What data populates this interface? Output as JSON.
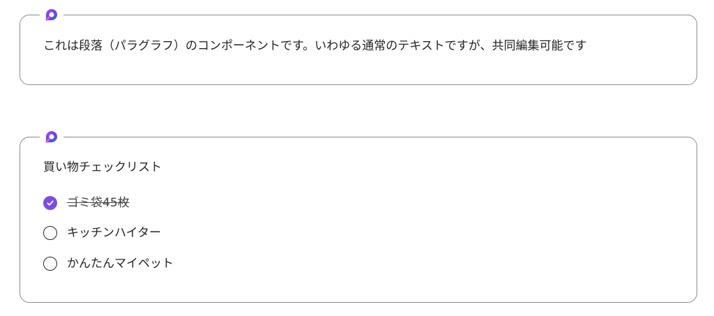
{
  "paragraph_component": {
    "logo_icon": "loop-logo-icon",
    "text": "これは段落（パラグラフ）のコンポーネントです。いわゆる通常のテキストですが、共同編集可能です"
  },
  "checklist_component": {
    "logo_icon": "loop-logo-icon",
    "title": "買い物チェックリスト",
    "items": [
      {
        "label": "ゴミ袋45枚",
        "checked": true
      },
      {
        "label": "キッチンハイター",
        "checked": false
      },
      {
        "label": "かんたんマイペット",
        "checked": false
      }
    ]
  },
  "colors": {
    "checkbox_checked": "#7b4de0",
    "border": "#8a8a8a",
    "text": "#242424"
  }
}
